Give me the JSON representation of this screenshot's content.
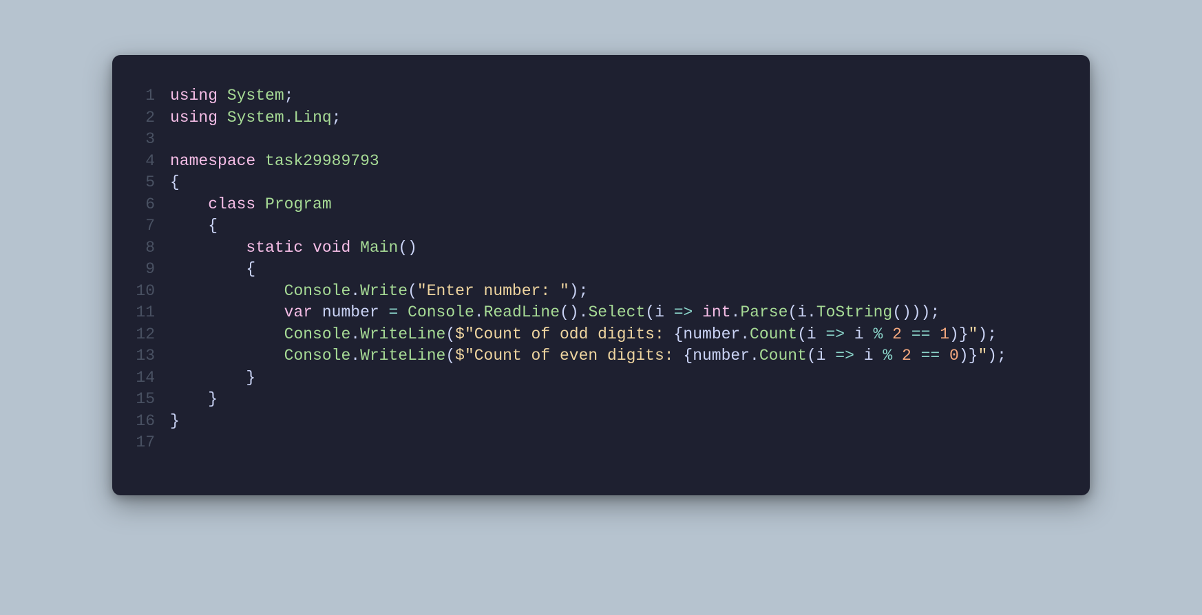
{
  "gutter": {
    "1": "1",
    "2": "2",
    "3": "3",
    "4": "4",
    "5": "5",
    "6": "6",
    "7": "7",
    "8": "8",
    "9": "9",
    "10": "10",
    "11": "11",
    "12": "12",
    "13": "13",
    "14": "14",
    "15": "15",
    "16": "16",
    "17": "17"
  },
  "tokens": {
    "using": "using",
    "System": "System",
    "semicolon": ";",
    "dot": ".",
    "Linq": "Linq",
    "namespace": "namespace",
    "ns_name": "task29989793",
    "lbrace": "{",
    "rbrace": "}",
    "class": "class",
    "Program": "Program",
    "static": "static",
    "void": "void",
    "Main": "Main",
    "lparen": "(",
    "rparen": ")",
    "Console": "Console",
    "Write": "Write",
    "str_enter": "\"Enter number: \"",
    "var": "var",
    "number": "number",
    "eq": "=",
    "ReadLine": "ReadLine",
    "Select": "Select",
    "i": "i",
    "arrow": "=>",
    "int": "int",
    "Parse": "Parse",
    "ToString": "ToString",
    "WriteLine": "WriteLine",
    "dollar": "$",
    "str_odd_1": "\"Count of odd digits: ",
    "str_odd_2": "\"",
    "str_even_1": "\"Count of even digits: ",
    "str_even_2": "\"",
    "Count": "Count",
    "mod": "%",
    "two": "2",
    "eqeq": "==",
    "one": "1",
    "zero": "0",
    "interp_l": "{",
    "interp_r": "}"
  }
}
